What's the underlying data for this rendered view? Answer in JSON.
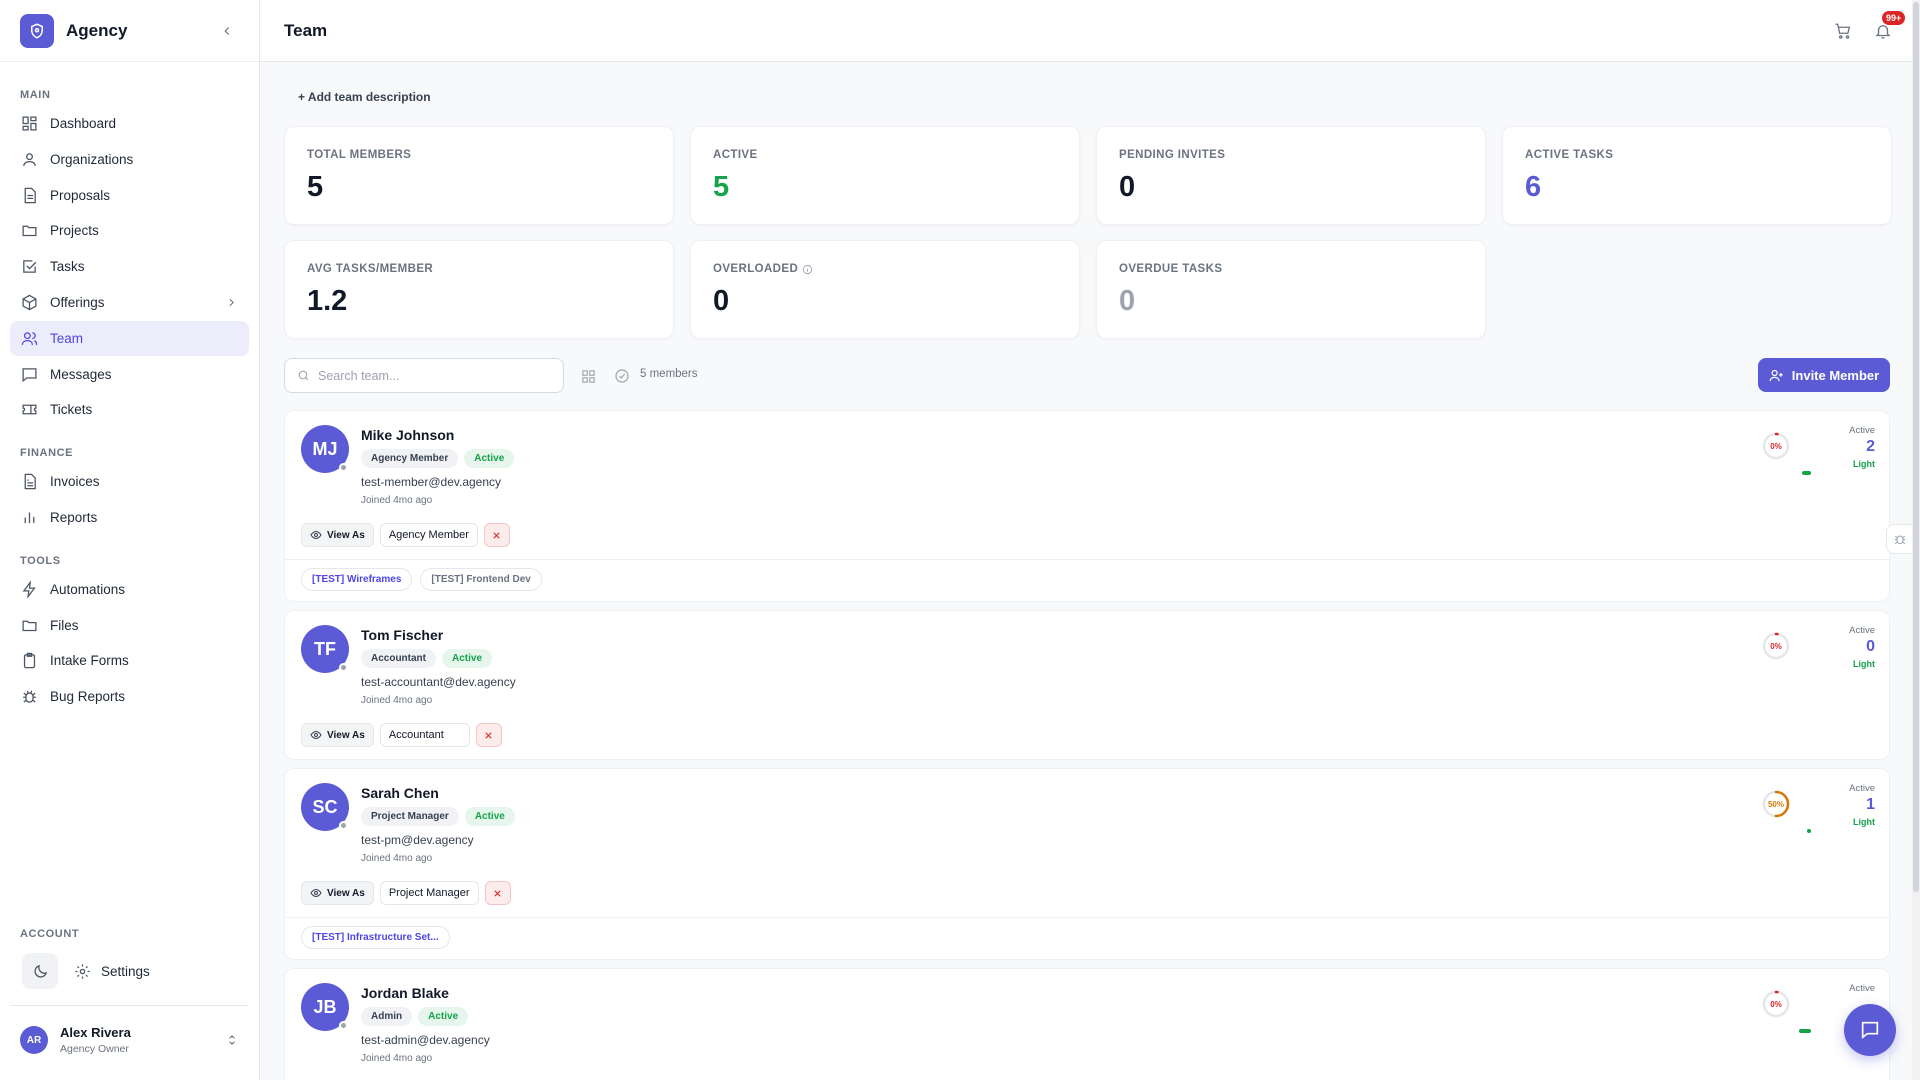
{
  "brand": {
    "name": "Agency"
  },
  "sidebar": {
    "sections": {
      "main": "MAIN",
      "finance": "FINANCE",
      "tools": "TOOLS",
      "account": "ACCOUNT"
    },
    "items": [
      {
        "label": "Dashboard",
        "icon": "grid-icon"
      },
      {
        "label": "Organizations",
        "icon": "user-icon"
      },
      {
        "label": "Proposals",
        "icon": "document-icon"
      },
      {
        "label": "Projects",
        "icon": "folder-icon"
      },
      {
        "label": "Tasks",
        "icon": "checkbox-icon"
      },
      {
        "label": "Offerings",
        "icon": "cube-icon"
      },
      {
        "label": "Team",
        "icon": "users-icon"
      },
      {
        "label": "Messages",
        "icon": "message-icon"
      },
      {
        "label": "Tickets",
        "icon": "ticket-icon"
      },
      {
        "label": "Invoices",
        "icon": "invoice-icon"
      },
      {
        "label": "Reports",
        "icon": "bar-chart-icon"
      },
      {
        "label": "Automations",
        "icon": "bolt-icon"
      },
      {
        "label": "Files",
        "icon": "folder-icon"
      },
      {
        "label": "Intake Forms",
        "icon": "clipboard-icon"
      },
      {
        "label": "Bug Reports",
        "icon": "bug-icon"
      }
    ],
    "settings_label": "Settings",
    "user": {
      "initials": "AR",
      "name": "Alex Rivera",
      "role": "Agency Owner"
    }
  },
  "header": {
    "title": "Team",
    "notifications": "99+"
  },
  "main": {
    "add_description": "+ Add team description",
    "stats": [
      {
        "label": "TOTAL MEMBERS",
        "value": "5",
        "color": "#111827"
      },
      {
        "label": "ACTIVE",
        "value": "5",
        "color": "#16a34a"
      },
      {
        "label": "PENDING INVITES",
        "value": "0",
        "color": "#111827"
      },
      {
        "label": "ACTIVE TASKS",
        "value": "6",
        "color": "#5b5bd6"
      },
      {
        "label": "AVG TASKS/MEMBER",
        "value": "1.2",
        "color": "#111827"
      },
      {
        "label": "OVERLOADED",
        "value": "0",
        "color": "#111827"
      },
      {
        "label": "OVERDUE TASKS",
        "value": "0",
        "color": "#9ca3af"
      }
    ],
    "search": {
      "placeholder": "Search team..."
    },
    "member_count": "5 members",
    "invite_label": "Invite Member",
    "view_as_label": "View As",
    "workload_active_label": "Active",
    "members": [
      {
        "initials": "MJ",
        "name": "Mike Johnson",
        "role": "Agency Member",
        "status": "Active",
        "email": "test-member@dev.agency",
        "joined": "Joined 4mo ago",
        "utilization": "0%",
        "utilization_value": 0,
        "active_tasks": "2",
        "workload": "Light",
        "workload_fill": 0.15,
        "projects": [
          "[TEST] Wireframes",
          "[TEST] Frontend Dev"
        ]
      },
      {
        "initials": "TF",
        "name": "Tom Fischer",
        "role": "Accountant",
        "status": "Active",
        "email": "test-accountant@dev.agency",
        "joined": "Joined 4mo ago",
        "utilization": "0%",
        "utilization_value": 0,
        "active_tasks": "0",
        "workload": "Light",
        "workload_fill": 0,
        "projects": []
      },
      {
        "initials": "SC",
        "name": "Sarah Chen",
        "role": "Project Manager",
        "status": "Active",
        "email": "test-pm@dev.agency",
        "joined": "Joined 4mo ago",
        "utilization": "50%",
        "utilization_value": 0.5,
        "active_tasks": "1",
        "workload": "Light",
        "workload_fill": 0.06,
        "projects": [
          "[TEST] Infrastructure Set..."
        ]
      },
      {
        "initials": "JB",
        "name": "Jordan Blake",
        "role": "Admin",
        "status": "Active",
        "email": "test-admin@dev.agency",
        "joined": "Joined 4mo ago",
        "utilization": "0%",
        "utilization_value": 0,
        "active_tasks": "",
        "workload": "",
        "workload_fill": 0.2,
        "projects": []
      }
    ]
  }
}
